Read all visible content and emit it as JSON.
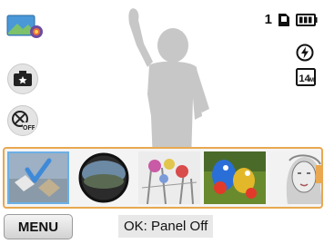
{
  "status": {
    "shot_count": "1"
  },
  "menu_label": "MENU",
  "hint_text": "OK: Panel Off",
  "filters": [
    {
      "name": "smart-filter-mini-icon",
      "selected": true
    },
    {
      "name": "fish-eye"
    },
    {
      "name": "sketch-flowers"
    },
    {
      "name": "parrot-colorize"
    },
    {
      "name": "portrait-sketch"
    }
  ],
  "colors": {
    "panel_border": "#e9a84f",
    "selected_border": "#6ab0e6",
    "silhouette": "#c7c7c7"
  },
  "icons": [
    "mode-picture-icon",
    "smart-filter-icon",
    "effect-off-icon",
    "memory-card-icon",
    "battery-icon",
    "flash-auto-icon",
    "resolution-14m-icon"
  ]
}
